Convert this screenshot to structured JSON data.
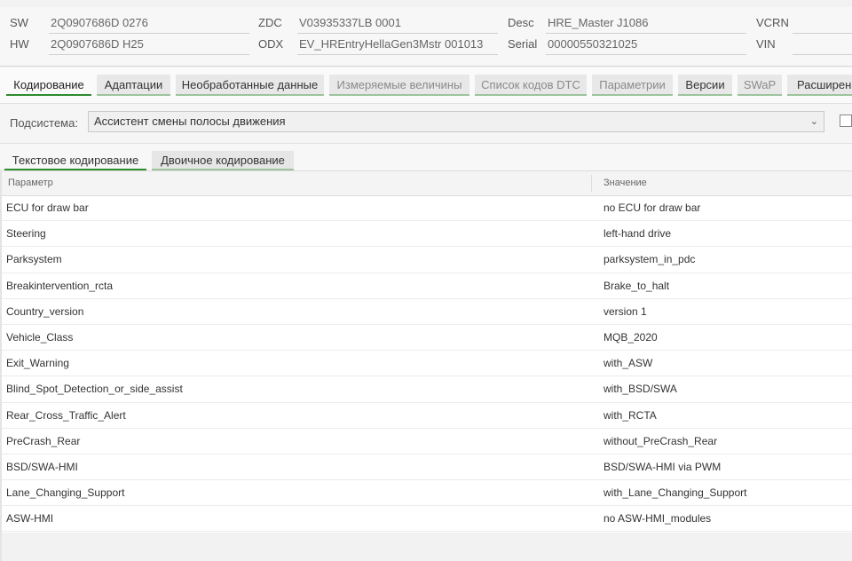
{
  "info": {
    "sw_label": "SW",
    "sw_value": "2Q0907686D 0276",
    "hw_label": "HW",
    "hw_value": "2Q0907686D H25",
    "zdc_label": "ZDC",
    "zdc_value": "V03935337LB 0001",
    "odx_label": "ODX",
    "odx_value": "EV_HREntryHellaGen3Mstr 001013",
    "desc_label": "Desc",
    "desc_value": "HRE_Master J1086",
    "serial_label": "Serial",
    "serial_value": "00000550321025",
    "vcrn_label": "VCRN",
    "vcrn_value": "",
    "vin_label": "VIN",
    "vin_value": ""
  },
  "main_tabs": [
    {
      "label": "Кодирование"
    },
    {
      "label": "Адаптации"
    },
    {
      "label": "Необработанные данные"
    },
    {
      "label": "Измеряемые величины"
    },
    {
      "label": "Список кодов DTC"
    },
    {
      "label": "Параметрии"
    },
    {
      "label": "Версии"
    },
    {
      "label": "SWaP"
    },
    {
      "label": "Расширенн"
    }
  ],
  "subsystem": {
    "label": "Подсистема:",
    "selected": "Ассистент смены полосы движения"
  },
  "sub_tabs": [
    {
      "label": "Текстовое кодирование"
    },
    {
      "label": "Двоичное кодирование"
    }
  ],
  "table": {
    "headers": {
      "param": "Параметр",
      "value": "Значение"
    },
    "rows": [
      {
        "param": "ECU for draw bar",
        "value": "no ECU for draw bar"
      },
      {
        "param": "Steering",
        "value": "left-hand drive"
      },
      {
        "param": "Parksystem",
        "value": "parksystem_in_pdc"
      },
      {
        "param": "Breakintervention_rcta",
        "value": "Brake_to_halt"
      },
      {
        "param": "Country_version",
        "value": "version 1"
      },
      {
        "param": "Vehicle_Class",
        "value": "MQB_2020"
      },
      {
        "param": "Exit_Warning",
        "value": "with_ASW"
      },
      {
        "param": "Blind_Spot_Detection_or_side_assist",
        "value": "with_BSD/SWA"
      },
      {
        "param": "Rear_Cross_Traffic_Alert",
        "value": "with_RCTA"
      },
      {
        "param": "PreCrash_Rear",
        "value": "without_PreCrash_Rear"
      },
      {
        "param": "BSD/SWA-HMI",
        "value": "BSD/SWA-HMI via PWM"
      },
      {
        "param": "Lane_Changing_Support",
        "value": "with_Lane_Changing_Support"
      },
      {
        "param": "ASW-HMI",
        "value": "no ASW-HMI_modules"
      }
    ]
  },
  "colors": {
    "accent": "#2e8b2e",
    "tab_bg": "#e8e8e8",
    "tab_underline": "#9dc39d"
  }
}
